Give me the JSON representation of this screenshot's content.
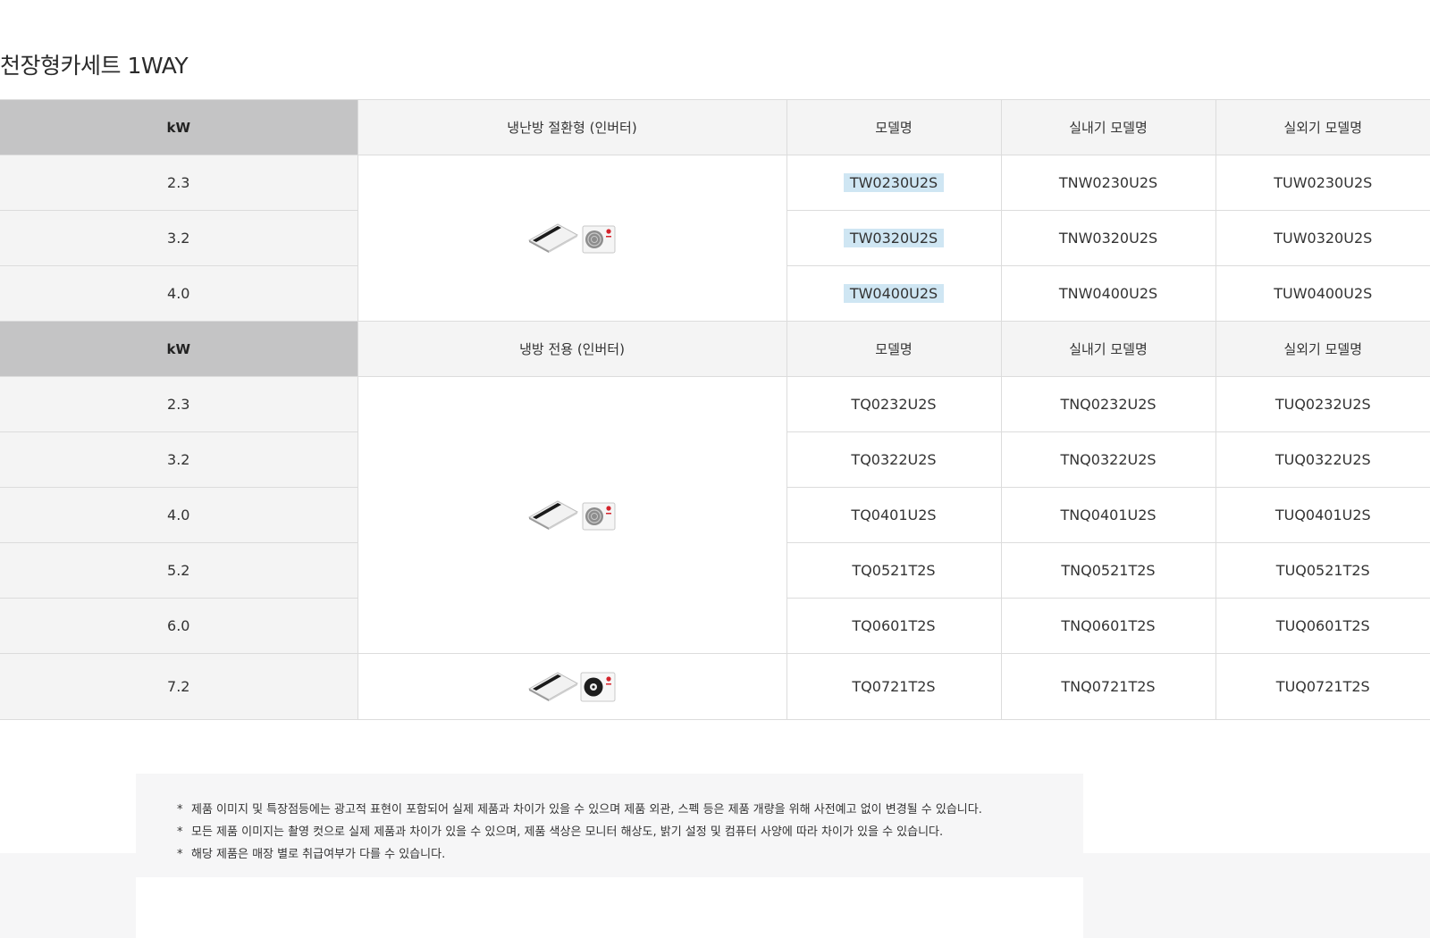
{
  "page": {
    "title": "천장형카세트 1WAY"
  },
  "table": {
    "section1": {
      "header": {
        "kw": "kW",
        "type": "냉난방 절환형 (인버터)",
        "model": "모델명",
        "indoor": "실내기 모델명",
        "outdoor": "실외기 모델명"
      },
      "rows": [
        {
          "kw": "2.3",
          "model": "TW0230U2S",
          "indoor": "TNW0230U2S",
          "outdoor": "TUW0230U2S"
        },
        {
          "kw": "3.2",
          "model": "TW0320U2S",
          "indoor": "TNW0320U2S",
          "outdoor": "TUW0320U2S"
        },
        {
          "kw": "4.0",
          "model": "TW0400U2S",
          "indoor": "TNW0400U2S",
          "outdoor": "TUW0400U2S"
        }
      ]
    },
    "section2": {
      "header": {
        "kw": "kW",
        "type": "냉방 전용 (인버터)",
        "model": "모델명",
        "indoor": "실내기 모델명",
        "outdoor": "실외기 모델명"
      },
      "rows": [
        {
          "kw": "2.3",
          "model": "TQ0232U2S",
          "indoor": "TNQ0232U2S",
          "outdoor": "TUQ0232U2S"
        },
        {
          "kw": "3.2",
          "model": "TQ0322U2S",
          "indoor": "TNQ0322U2S",
          "outdoor": "TUQ0322U2S"
        },
        {
          "kw": "4.0",
          "model": "TQ0401U2S",
          "indoor": "TNQ0401U2S",
          "outdoor": "TUQ0401U2S"
        },
        {
          "kw": "5.2",
          "model": "TQ0521T2S",
          "indoor": "TNQ0521T2S",
          "outdoor": "TUQ0521T2S"
        },
        {
          "kw": "6.0",
          "model": "TQ0601T2S",
          "indoor": "TNQ0601T2S",
          "outdoor": "TUQ0601T2S"
        },
        {
          "kw": "7.2",
          "model": "TQ0721T2S",
          "indoor": "TNQ0721T2S",
          "outdoor": "TUQ0721T2S"
        }
      ]
    },
    "highlight_color": "#cfe6f3",
    "kw_header_color": "#c4c4c5"
  },
  "notes": {
    "bullet": "*",
    "items": [
      "제품 이미지 및 특장점등에는 광고적 표현이 포함되어 실제 제품과 차이가 있을 수 있으며 제품 외관, 스펙 등은 제품 개량을 위해 사전예고 없이 변경될 수 있습니다.",
      "모든 제품 이미지는 촬영 컷으로 실제 제품과 차이가 있을 수 있으며, 제품 색상은 모니터 해상도, 밝기 설정 및 컴퓨터 사양에 따라 차이가 있을 수 있습니다.",
      "해당 제품은 매장 별로 취급여부가 다를 수 있습니다."
    ]
  }
}
